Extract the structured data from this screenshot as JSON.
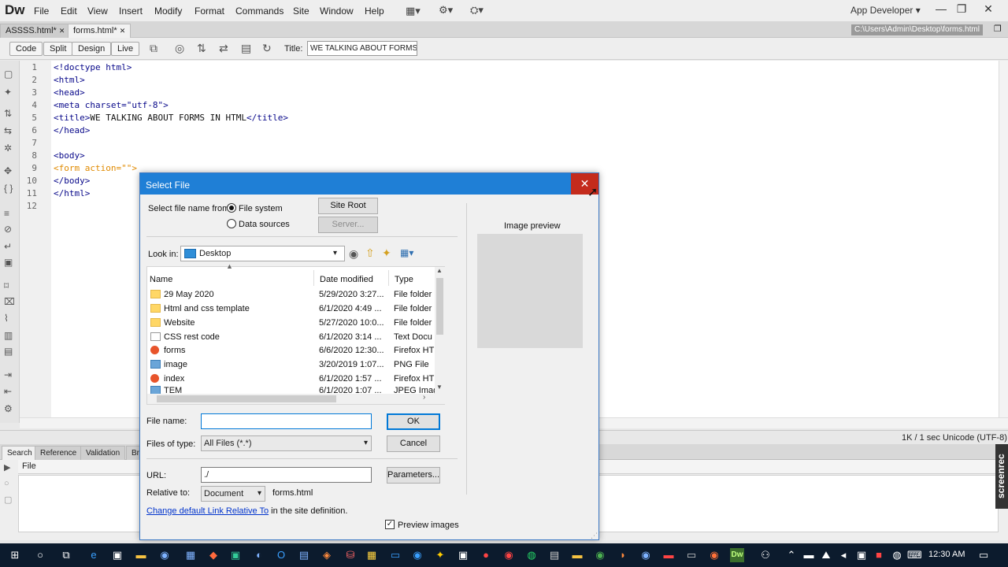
{
  "app": {
    "logo": "Dw",
    "menu": [
      "File",
      "Edit",
      "View",
      "Insert",
      "Modify",
      "Format",
      "Commands",
      "Site",
      "Window",
      "Help"
    ],
    "workspace": "App Developer",
    "window_buttons": {
      "minimize": "—",
      "restore": "❐",
      "close": "✕"
    }
  },
  "tabs": [
    {
      "label": "ASSSS.html*"
    },
    {
      "label": "forms.html*"
    }
  ],
  "path": "C:\\Users\\Admin\\Desktop\\forms.html",
  "toolbar": {
    "views": [
      "Code",
      "Split",
      "Design",
      "Live"
    ],
    "title_label": "Title:",
    "title_value": "WE TALKING ABOUT FORMS IN HTML"
  },
  "code": {
    "line_numbers": [
      "1",
      "2",
      "3",
      "4",
      "5",
      "6",
      "7",
      "8",
      "9",
      "10",
      "11",
      "12"
    ],
    "lines": [
      "<!doctype html>",
      "<html>",
      "<head>",
      "<meta charset=\"utf-8\">",
      "<title>",
      "WE TALKING ABOUT FORMS IN HTML",
      "</title>",
      "</head>",
      "<body>",
      "<form action=\"\">",
      "</body>",
      "</html>"
    ]
  },
  "status": {
    "text": "1K / 1 sec  Unicode (UTF-8)"
  },
  "panel": {
    "tabs": [
      "Search",
      "Reference",
      "Validation",
      "Br"
    ],
    "column": "File",
    "watermark": "screenrec"
  },
  "dialog": {
    "title": "Select File",
    "close": "✕",
    "select_from_label": "Select file name from:",
    "radio_file_system": "File system",
    "radio_data_sources": "Data sources",
    "site_root": "Site Root",
    "server": "Server...",
    "look_in_label": "Look in:",
    "look_in_value": "Desktop",
    "columns": {
      "name": "Name",
      "date": "Date modified",
      "type": "Type"
    },
    "files": [
      {
        "name": "29 May 2020",
        "date": "5/29/2020 3:27...",
        "type": "File folder",
        "icon": "folder-icon"
      },
      {
        "name": "Html and css template",
        "date": "6/1/2020 4:49 ...",
        "type": "File folder",
        "icon": "folder-icon"
      },
      {
        "name": "Website",
        "date": "5/27/2020 10:0...",
        "type": "File folder",
        "icon": "folder-icon"
      },
      {
        "name": "CSS rest code",
        "date": "6/1/2020 3:14 ...",
        "type": "Text Docu",
        "icon": "text-file-icon"
      },
      {
        "name": "forms",
        "date": "6/6/2020 12:30...",
        "type": "Firefox HT",
        "icon": "firefox-icon"
      },
      {
        "name": "image",
        "date": "3/20/2019 1:07...",
        "type": "PNG File",
        "icon": "image-file-icon"
      },
      {
        "name": "index",
        "date": "6/1/2020 1:57 ...",
        "type": "Firefox HT",
        "icon": "firefox-icon"
      },
      {
        "name": "TEM",
        "date": "6/1/2020 1:07 ...",
        "type": "JPEG Imag",
        "icon": "image-file-icon"
      }
    ],
    "image_preview_label": "Image preview",
    "file_name_label": "File name:",
    "file_name_value": "",
    "files_of_type_label": "Files of type:",
    "files_of_type_value": "All Files (*.*)",
    "ok": "OK",
    "cancel": "Cancel",
    "url_label": "URL:",
    "url_value": "./",
    "parameters": "Parameters...",
    "relative_to_label": "Relative to:",
    "relative_to_value": "Document",
    "relative_file": "forms.html",
    "change_link": "Change default Link Relative To",
    "change_suffix": " in the site definition.",
    "preview_images": "Preview images"
  },
  "taskbar": {
    "time": "12:30 AM"
  }
}
